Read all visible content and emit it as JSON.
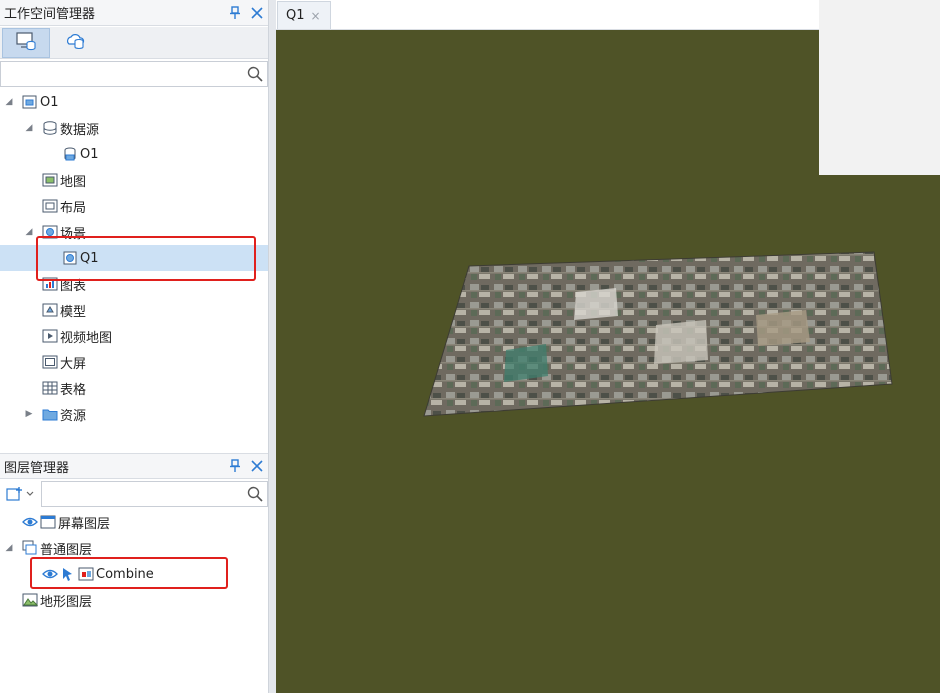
{
  "workspace_panel": {
    "title": "工作空间管理器",
    "search_placeholder": "",
    "tree": {
      "root": "O1",
      "datasource_label": "数据源",
      "datasource_child": "O1",
      "map": "地图",
      "layout": "布局",
      "scene": "场景",
      "scene_child": "Q1",
      "chart": "图表",
      "model": "模型",
      "video_map": "视频地图",
      "big_screen": "大屏",
      "table": "表格",
      "resources": "资源"
    }
  },
  "layer_panel": {
    "title": "图层管理器",
    "search_placeholder": "",
    "screen_layer": "屏幕图层",
    "normal_layer": "普通图层",
    "combine": "Combine",
    "terrain_layer": "地形图层"
  },
  "document": {
    "tab_label": "Q1",
    "tab_close": "×"
  },
  "icons": {
    "pin": "pin-icon",
    "close": "close-icon",
    "search": "search-icon",
    "eye": "eye-icon"
  },
  "colors": {
    "accent": "#2d7bd3",
    "selection": "#cce1f5",
    "highlight_box": "#e0201d",
    "scene_bg": "#4f5327"
  }
}
